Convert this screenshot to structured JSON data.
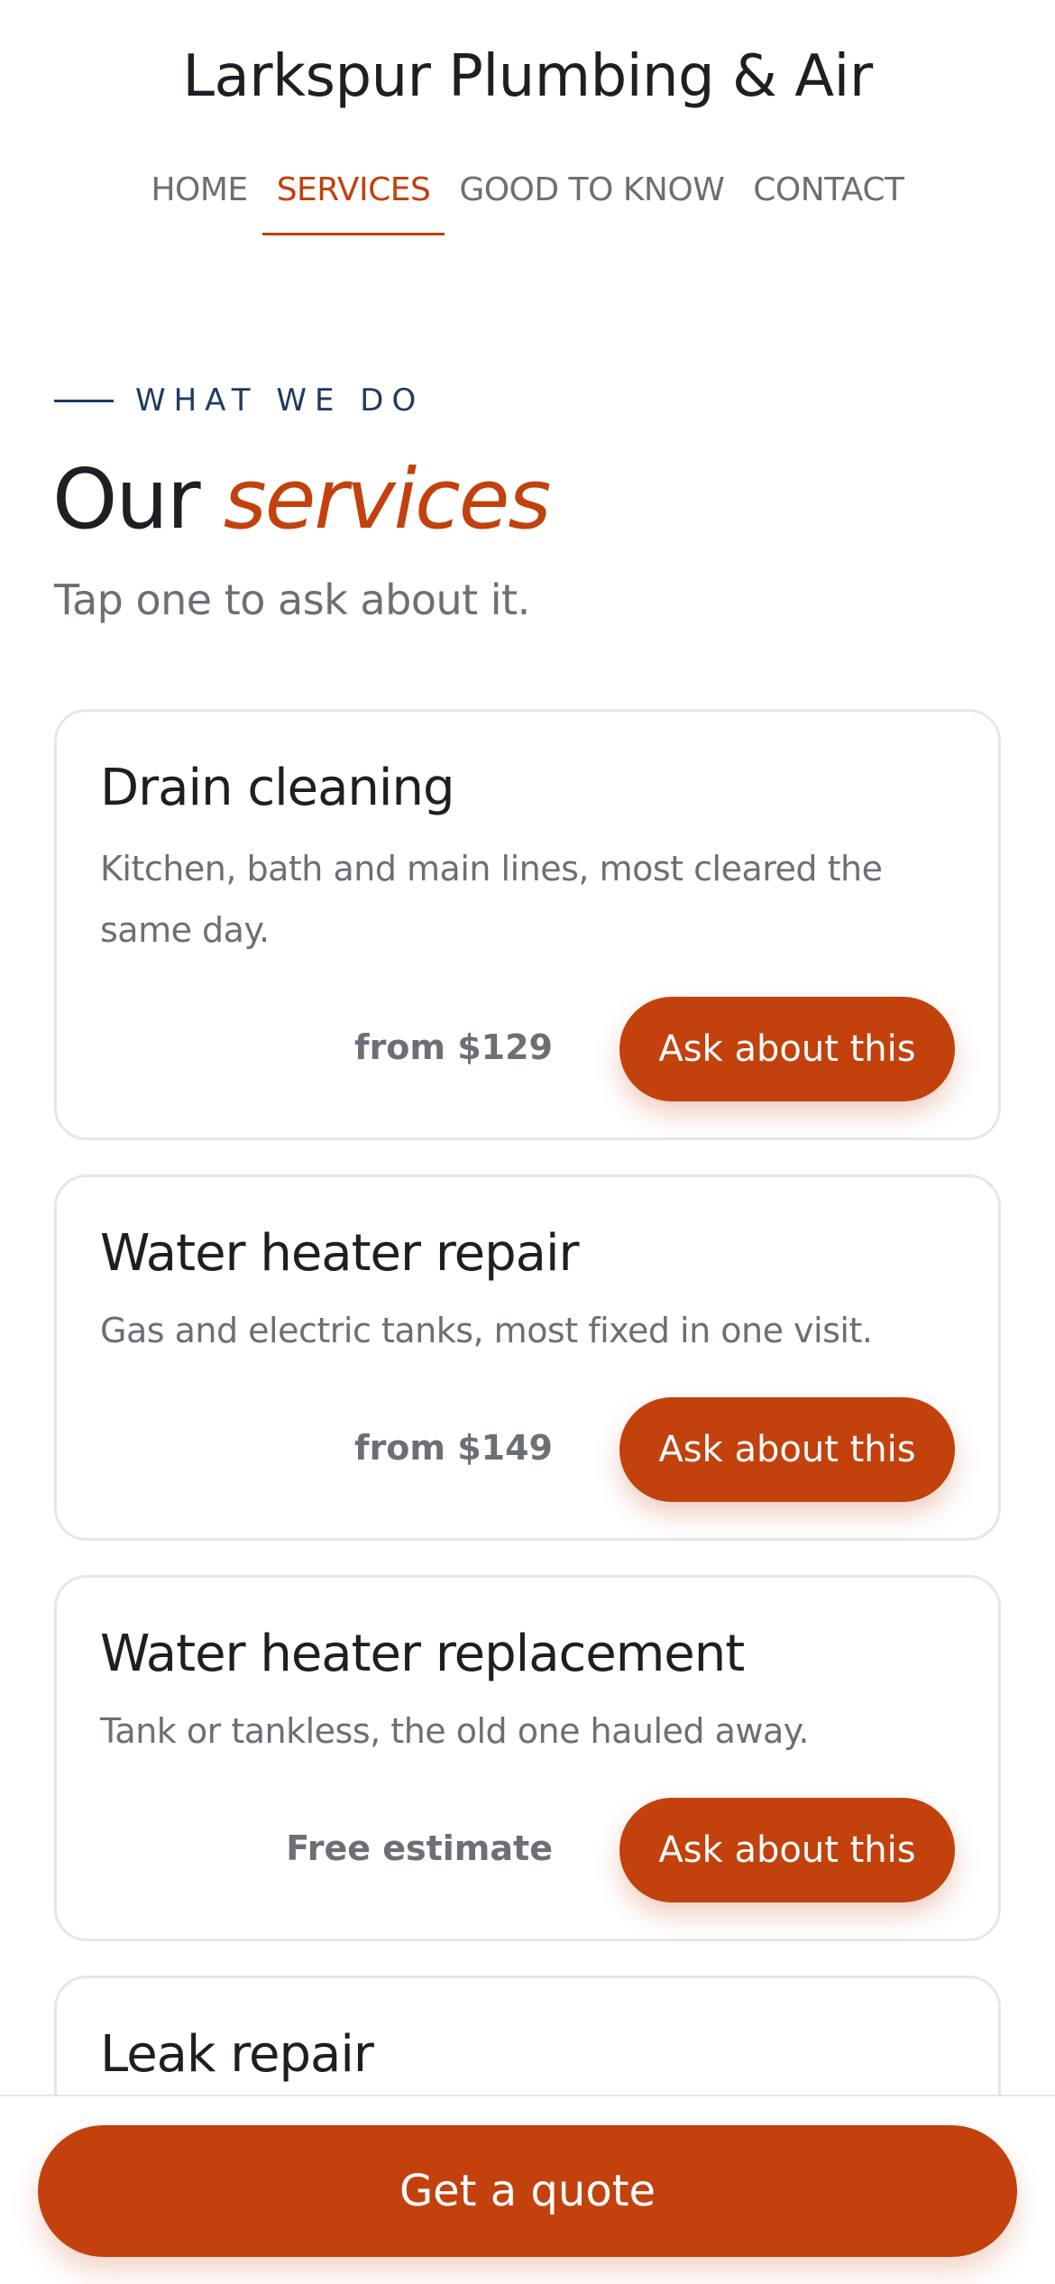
{
  "header": {
    "site_title": "Larkspur Plumbing & Air",
    "nav": [
      {
        "label": "HOME",
        "active": false
      },
      {
        "label": "SERVICES",
        "active": true
      },
      {
        "label": "GOOD TO KNOW",
        "active": false
      },
      {
        "label": "CONTACT",
        "active": false
      }
    ]
  },
  "section": {
    "eyebrow": "WHAT WE DO",
    "heading_plain": "Our",
    "heading_accent": "services",
    "subheading": "Tap one to ask about it."
  },
  "services": [
    {
      "title": "Drain cleaning",
      "description": "Kitchen, bath and main lines, most cleared the same day.",
      "price": "from $129",
      "button_label": "Ask about this"
    },
    {
      "title": "Water heater repair",
      "description": "Gas and electric tanks, most fixed in one visit.",
      "price": "from $149",
      "button_label": "Ask about this"
    },
    {
      "title": "Water heater replacement",
      "description": "Tank or tankless, the old one hauled away.",
      "price": "Free estimate",
      "button_label": "Ask about this"
    },
    {
      "title": "Leak repair"
    }
  ],
  "footer": {
    "cta_label": "Get a quote"
  },
  "colors": {
    "accent": "#c2410c",
    "navy": "#1e3a5f",
    "text": "#1c1f24",
    "muted": "#6b6f76",
    "border": "#e4e6e9"
  }
}
